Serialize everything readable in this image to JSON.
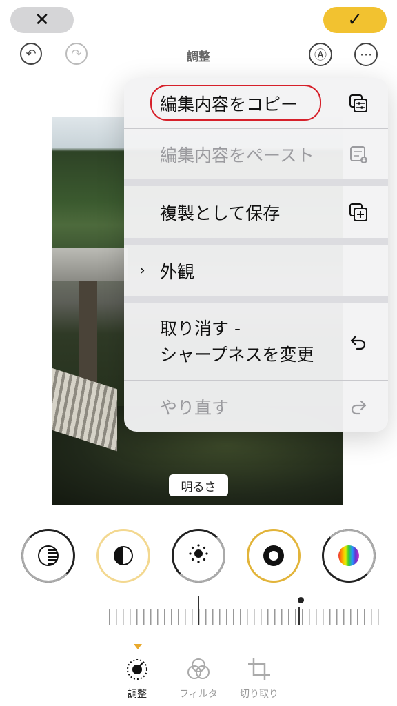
{
  "topbar": {
    "cancel_icon": "✕",
    "done_icon": "✓",
    "undo_icon": "↶",
    "redo_icon": "↷",
    "markup_icon": "Ⓐ",
    "more_icon": "⋯",
    "title": "調整",
    "done_color": "#f2c230"
  },
  "menu": {
    "copy_edits": "編集内容をコピー",
    "paste_edits": "編集内容をペースト",
    "save_as_duplicate": "複製として保存",
    "appearance": "外観",
    "undo_line1": "取り消す -",
    "undo_line2": "シャープネスを変更",
    "redo": "やり直す",
    "copy_icon": "⧉",
    "paste_icon": "☷",
    "duplicate_icon": "⊞",
    "undo_icon": "↶",
    "redo_icon": "↷",
    "chevron": "›"
  },
  "photo": {
    "overlay_label": "明るさ"
  },
  "dials": [
    "exposure",
    "brilliance",
    "highlights",
    "brightness",
    "saturation"
  ],
  "tabs": {
    "adjust": "調整",
    "filter": "フィルタ",
    "crop": "切り取り",
    "adjust_icon": "◔",
    "filter_icon": "◎",
    "crop_icon": "⌗"
  }
}
